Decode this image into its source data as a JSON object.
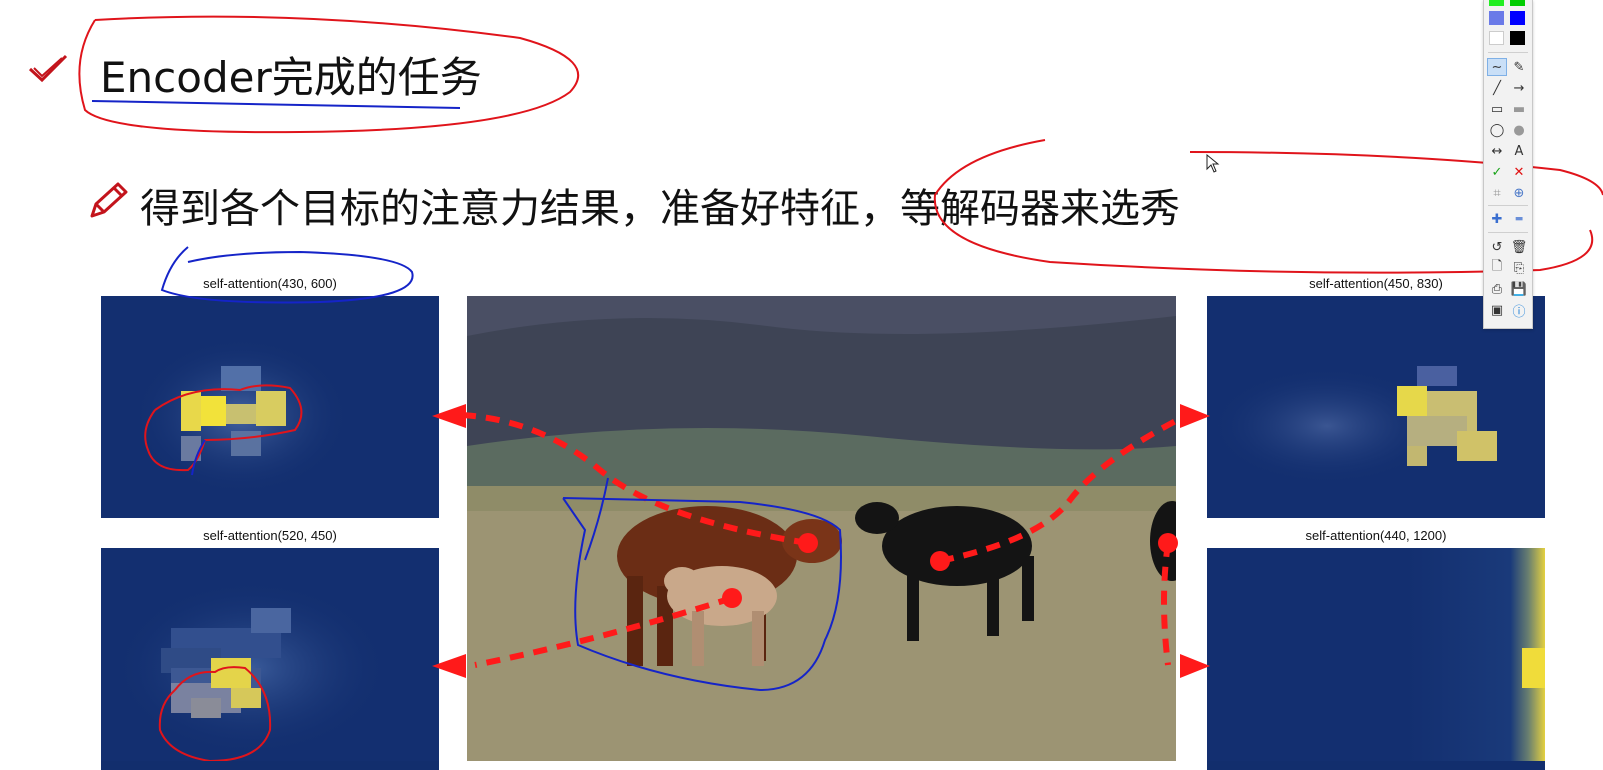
{
  "slide": {
    "heading": "Encoder完成的任务",
    "bullet": "得到各个目标的注意力结果，准备好特征，等解码器来选秀",
    "icons": {
      "heading_icon": "check-icon",
      "bullet_icon": "pencil-icon"
    }
  },
  "panels": [
    {
      "title": "self-attention(430, 600)"
    },
    {
      "title": "self-attention(520, 450)"
    },
    {
      "title": "self-attention(450, 830)"
    },
    {
      "title": "self-attention(440, 1200)"
    }
  ],
  "toolbar": {
    "tools": {
      "freehand": "∼",
      "highlighter": "✎",
      "line": "╱",
      "arrow": "→",
      "rect": "▭",
      "rect_filled": "▬",
      "ellipse": "◯",
      "ellipse_filled": "●",
      "double_arrow": "↔",
      "text": "A",
      "check": "✓",
      "cross": "✕",
      "crop": "⌗",
      "zoom": "⊕",
      "plus": "✚",
      "minus": "▬",
      "undo": "↺",
      "delete": "🗑",
      "new": "🗋",
      "copy": "⎘",
      "print": "⎙",
      "save": "💾",
      "screen": "▣",
      "info": "ⓘ"
    },
    "colors": {
      "green": "#22ee22",
      "bright_green": "#00cc00",
      "gradient": "#6a7ae8",
      "blue": "#0000ff",
      "white": "#ffffff",
      "black": "#000000"
    }
  },
  "annotation_colors": {
    "red": "#e0141b",
    "blue": "#1524c8",
    "arrow_red": "#ff1a1a"
  }
}
